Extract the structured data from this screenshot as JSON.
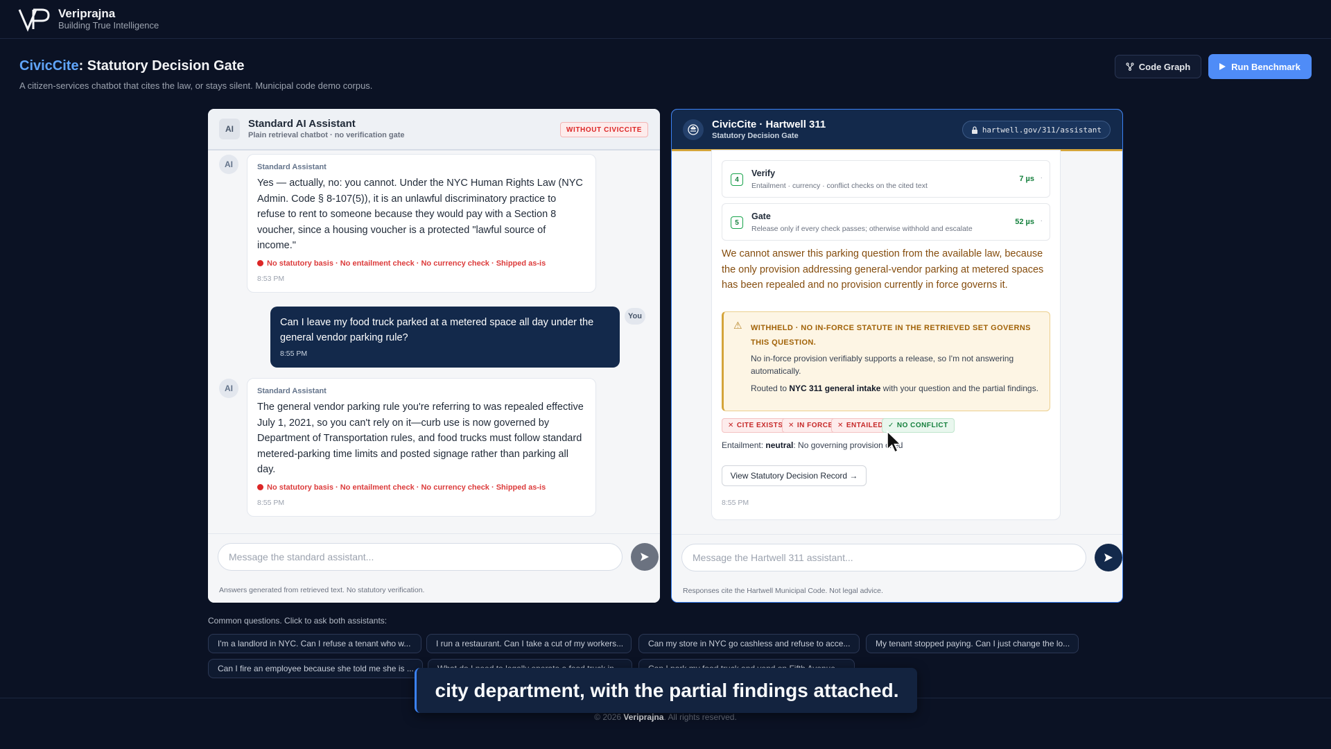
{
  "brand": {
    "name": "Veriprajna",
    "tagline": "Building True Intelligence"
  },
  "header": {
    "title_accent": "CivicCite",
    "title_rest": ": Statutory Decision Gate",
    "subtitle": "A citizen-services chatbot that cites the law, or stays silent. Municipal code demo corpus.",
    "code_graph_label": "Code Graph",
    "run_benchmark_label": "Run Benchmark"
  },
  "left_panel": {
    "avatar": "AI",
    "title": "Standard AI Assistant",
    "subtitle": "Plain retrieval chatbot · no verification gate",
    "badge": "WITHOUT CIVICCITE",
    "messages": [
      {
        "avatar": "AI",
        "sender": "Standard Assistant",
        "text": "Yes — actually, no: you cannot. Under the NYC Human Rights Law (NYC Admin. Code § 8-107(5)), it is an unlawful discriminatory practice to refuse to rent to someone because they would pay with a Section 8 voucher, since a housing voucher is a protected \"lawful source of income.\"",
        "flags": "No statutory basis · No entailment check · No currency check · Shipped as-is",
        "time": "8:53 PM"
      },
      {
        "avatar": "AI",
        "sender": "Standard Assistant",
        "text": "The general vendor parking rule you're referring to was repealed effective July 1, 2021, so you can't rely on it—curb use is now governed by Department of Transportation rules, and food trucks must follow standard metered-parking time limits and posted signage rather than parking all day.",
        "flags": "No statutory basis · No entailment check · No currency check · Shipped as-is",
        "time": "8:55 PM"
      }
    ],
    "user_message": {
      "text": "Can I leave my food truck parked at a metered space all day under the general vendor parking rule?",
      "time": "8:55 PM",
      "tag": "You"
    },
    "composer_placeholder": "Message the standard assistant...",
    "footnote": "Answers generated from retrieved text. No statutory verification."
  },
  "right_panel": {
    "title": "CivicCite · Hartwell 311",
    "subtitle": "Statutory Decision Gate",
    "url": "hartwell.gov/311/assistant",
    "steps": [
      {
        "num": "4",
        "title": "Verify",
        "desc": "Entailment · currency · conflict checks on the cited text",
        "ms": "7 µs"
      },
      {
        "num": "5",
        "title": "Gate",
        "desc": "Release only if every check passes; otherwise withhold and escalate",
        "ms": "52 µs"
      }
    ],
    "answer": "We cannot answer this parking question from the available law, because the only provision addressing general-vendor parking at metered spaces has been repealed and no provision currently in force governs it.",
    "withheld": {
      "title": "WITHHELD · NO IN-FORCE STATUTE IN THE RETRIEVED SET GOVERNS THIS QUESTION.",
      "text1": "No in-force provision verifiably supports a release, so I'm not answering automatically.",
      "text2_pre": "Routed to ",
      "text2_bold": "NYC 311 general intake",
      "text2_post": " with your question and the partial findings."
    },
    "checks": [
      {
        "label": "CITE EXISTS",
        "ok": false
      },
      {
        "label": "IN FORCE",
        "ok": false
      },
      {
        "label": "ENTAILED",
        "ok": false
      },
      {
        "label": "NO CONFLICT",
        "ok": true
      }
    ],
    "entailment_label": "Entailment: ",
    "entailment_value": "neutral",
    "entailment_note": ": No governing provision cited",
    "record_button": "View Statutory Decision Record →",
    "time": "8:55 PM",
    "composer_placeholder": "Message the Hartwell 311 assistant...",
    "footnote": "Responses cite the Hartwell Municipal Code. Not legal advice."
  },
  "common_questions": {
    "label": "Common questions. Click to ask both assistants:",
    "items": [
      "I'm a landlord in NYC. Can I refuse a tenant who w...",
      "I run a restaurant. Can I take a cut of my workers...",
      "Can my store in NYC go cashless and refuse to acce...",
      "My tenant stopped paying. Can I just change the lo...",
      "Can I fire an employee because she told me she is ...",
      "What do I need to legally operate a food truck in...",
      "Can I park my food truck and vend on Fifth Avenue..."
    ]
  },
  "footer": {
    "pre": "© 2026 ",
    "brand": "Veriprajna",
    "post": ". All rights reserved."
  },
  "caption": "city department, with the partial findings attached.",
  "colors": {
    "accent": "#60a5fa",
    "navy": "#13294b",
    "gold": "#d4a43a",
    "bad": "#dc2626",
    "good": "#15803d"
  },
  "icons": [
    "logo-mark",
    "code-graph-icon",
    "play-icon",
    "assistant-icon",
    "lock-icon",
    "send-icon",
    "warning-icon",
    "x-icon",
    "check-icon",
    "mouse-cursor"
  ]
}
